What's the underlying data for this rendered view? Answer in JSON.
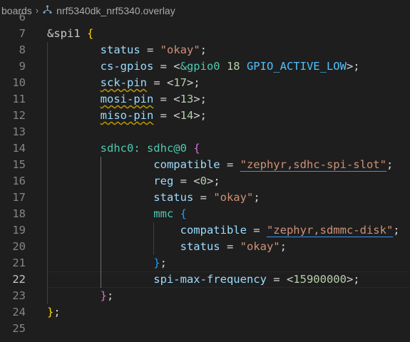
{
  "breadcrumb": {
    "folder": "boards",
    "separator": "›",
    "file_icon": "devicetree-file-icon",
    "file": "nrf5340dk_nrf5340.overlay"
  },
  "editor": {
    "partial_top_line": "6",
    "current_line": "22",
    "lines": [
      {
        "n": "7",
        "tokens": [
          [
            "&spi1 ",
            "t-label"
          ],
          [
            "{",
            "t-b1"
          ]
        ]
      },
      {
        "n": "8",
        "tokens": [
          [
            "        status",
            "t-prop"
          ],
          [
            " = ",
            "t-punc"
          ],
          [
            "\"okay\"",
            "t-str"
          ],
          [
            ";",
            "t-punc"
          ]
        ]
      },
      {
        "n": "9",
        "tokens": [
          [
            "        cs-gpios",
            "t-prop"
          ],
          [
            " = <",
            "t-punc"
          ],
          [
            "&gpio0",
            "t-ref"
          ],
          [
            " 18 ",
            "t-num"
          ],
          [
            "GPIO_ACTIVE_LOW",
            "t-macro"
          ],
          [
            ">;",
            "t-punc"
          ]
        ]
      },
      {
        "n": "10",
        "tokens": [
          [
            "        ",
            "t-punc"
          ],
          [
            "sck-pin",
            "t-prop squiggle"
          ],
          [
            " = <",
            "t-punc"
          ],
          [
            "17",
            "t-num"
          ],
          [
            ">;",
            "t-punc"
          ]
        ]
      },
      {
        "n": "11",
        "tokens": [
          [
            "        ",
            "t-punc"
          ],
          [
            "mosi-pin",
            "t-prop squiggle"
          ],
          [
            " = <",
            "t-punc"
          ],
          [
            "13",
            "t-num"
          ],
          [
            ">;",
            "t-punc"
          ]
        ]
      },
      {
        "n": "12",
        "tokens": [
          [
            "        ",
            "t-punc"
          ],
          [
            "miso-pin",
            "t-prop squiggle"
          ],
          [
            " = <",
            "t-punc"
          ],
          [
            "14",
            "t-num"
          ],
          [
            ">;",
            "t-punc"
          ]
        ]
      },
      {
        "n": "13",
        "tokens": []
      },
      {
        "n": "14",
        "tokens": [
          [
            "        sdhc0: sdhc@0 ",
            "t-ref"
          ],
          [
            "{",
            "t-b2"
          ]
        ]
      },
      {
        "n": "15",
        "tokens": [
          [
            "                compatible",
            "t-prop"
          ],
          [
            " = ",
            "t-punc"
          ],
          [
            "\"zephyr,sdhc-spi-slot\"",
            "t-str link-ul"
          ],
          [
            ";",
            "t-punc"
          ]
        ]
      },
      {
        "n": "16",
        "tokens": [
          [
            "                reg",
            "t-prop"
          ],
          [
            " = <",
            "t-punc"
          ],
          [
            "0",
            "t-num"
          ],
          [
            ">;",
            "t-punc"
          ]
        ]
      },
      {
        "n": "17",
        "tokens": [
          [
            "                status",
            "t-prop"
          ],
          [
            " = ",
            "t-punc"
          ],
          [
            "\"okay\"",
            "t-str"
          ],
          [
            ";",
            "t-punc"
          ]
        ]
      },
      {
        "n": "18",
        "tokens": [
          [
            "                mmc ",
            "t-ref"
          ],
          [
            "{",
            "t-b3"
          ]
        ]
      },
      {
        "n": "19",
        "tokens": [
          [
            "                    compatible",
            "t-prop"
          ],
          [
            " = ",
            "t-punc"
          ],
          [
            "\"zephyr,sdmmc-disk\"",
            "t-str link-ul"
          ],
          [
            ";",
            "t-punc"
          ]
        ]
      },
      {
        "n": "20",
        "tokens": [
          [
            "                    status",
            "t-prop"
          ],
          [
            " = ",
            "t-punc"
          ],
          [
            "\"okay\"",
            "t-str"
          ],
          [
            ";",
            "t-punc"
          ]
        ]
      },
      {
        "n": "21",
        "tokens": [
          [
            "                ",
            "t-punc"
          ],
          [
            "}",
            "t-b3"
          ],
          [
            ";",
            "t-punc"
          ]
        ]
      },
      {
        "n": "22",
        "tokens": [
          [
            "                spi-max-frequency",
            "t-prop"
          ],
          [
            " = <",
            "t-punc"
          ],
          [
            "15900000",
            "t-num"
          ],
          [
            ">;",
            "t-punc"
          ]
        ]
      },
      {
        "n": "23",
        "tokens": [
          [
            "        ",
            "t-punc"
          ],
          [
            "}",
            "t-b2"
          ],
          [
            ";",
            "t-punc"
          ]
        ]
      },
      {
        "n": "24",
        "tokens": [
          [
            "}",
            "t-b1"
          ],
          [
            ";",
            "t-punc"
          ]
        ]
      },
      {
        "n": "25",
        "tokens": []
      }
    ]
  }
}
